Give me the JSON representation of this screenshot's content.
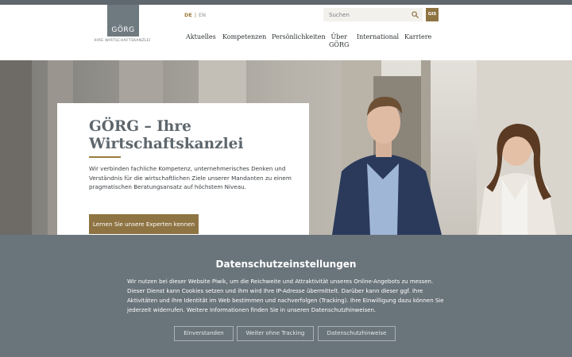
{
  "colors": {
    "brand_grey": "#6f7a80",
    "accent_gold": "#8f7443",
    "consent_bg": "#6a747b"
  },
  "logo": {
    "wordmark": "GÖRG",
    "tagline": "IHRE WIRTSCHAFTSKANZLEI"
  },
  "language": {
    "active": "DE",
    "separator": "|",
    "other": "EN"
  },
  "search": {
    "placeholder": "Suchen",
    "icon": "search-icon"
  },
  "gis_button": {
    "label": "GIS"
  },
  "nav": {
    "items": [
      {
        "label": "Aktuelles"
      },
      {
        "label": "Kompetenzen"
      },
      {
        "label": "Persönlichkeiten"
      },
      {
        "label": "Über",
        "label2": "GÖRG"
      },
      {
        "label": "International"
      },
      {
        "label": "Karriere"
      }
    ]
  },
  "hero": {
    "title_line1": "GÖRG – Ihre",
    "title_line2": "Wirtschaftskanzlei",
    "text": "Wir verbinden fachliche Kompetenz, unternehmerisches Denken und Verständnis für die wirtschaftlichen Ziele unserer Mandanten zu einem pragmatischen Beratungsansatz auf höchstem Niveau.",
    "cta": "Lernen Sie unsere Experten kennen"
  },
  "consent": {
    "title": "Datenschutzeinstellungen",
    "text": "Wir nutzen bei dieser Website Piwik, um die Reichweite und Attraktivität unseres Online-Angebots zu messen. Dieser Dienst kann Cookies setzen und ihm wird Ihre IP-Adresse übermittelt. Darüber kann dieser ggf. Ihre Aktivitäten und Ihre Identität im Web bestimmen und nachverfolgen (Tracking). Ihre Einwilligung dazu können Sie jederzeit widerrufen. Weitere Informationen finden Sie in unseren Datenschutzhinweisen.",
    "buttons": {
      "accept": "Einverstanden",
      "no_tracking": "Weiter ohne Tracking",
      "privacy": "Datenschutzhinweise"
    }
  }
}
